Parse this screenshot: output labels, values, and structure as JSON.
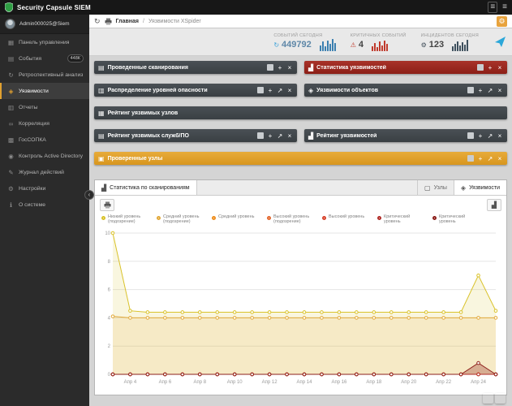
{
  "topbar": {
    "title": "Security Capsule SIEM"
  },
  "sidebar": {
    "user": "Admin000025@Siem",
    "items": [
      {
        "id": "dashboard",
        "label": "Панель управления",
        "icon": "dashboard"
      },
      {
        "id": "events",
        "label": "События",
        "icon": "events",
        "badge": "448К"
      },
      {
        "id": "retrospective",
        "label": "Ретроспективный анализ",
        "icon": "history"
      },
      {
        "id": "vulnerabilities",
        "label": "Уязвимости",
        "icon": "shield",
        "active": true
      },
      {
        "id": "reports",
        "label": "Отчеты",
        "icon": "report"
      },
      {
        "id": "correlation",
        "label": "Корреляция",
        "icon": "correlation"
      },
      {
        "id": "gossopka",
        "label": "ГосСОПКА",
        "icon": "tower"
      },
      {
        "id": "ad-control",
        "label": "Контроль Active Directory",
        "icon": "ad"
      },
      {
        "id": "action-log",
        "label": "Журнал действий",
        "icon": "journal"
      },
      {
        "id": "settings",
        "label": "Настройки",
        "icon": "settings"
      },
      {
        "id": "about",
        "label": "О системе",
        "icon": "info"
      }
    ]
  },
  "breadcrumb": {
    "home": "Главная",
    "sep": "/",
    "current": "Уязвимости XSpider"
  },
  "stats": {
    "items": [
      {
        "label": "СОБЫТИЙ СЕГОДНЯ",
        "icon": "refresh",
        "icon_color": "#3aa0d9",
        "value": "449792",
        "value_color": "#5e87a8",
        "spark": {
          "color": "#3a7fb0",
          "bars": [
            45,
            75,
            35,
            85,
            55,
            95,
            65
          ]
        }
      },
      {
        "label": "КРИТИЧНЫХ СОБЫТИЙ",
        "icon": "warning",
        "icon_color": "#c0392b",
        "value": "4",
        "value_color": "#444444",
        "spark": {
          "color": "#c0392b",
          "bars": [
            35,
            65,
            30,
            75,
            45,
            85,
            55
          ]
        }
      },
      {
        "label": "ИНЦИДЕНТОВ СЕГОДНЯ",
        "icon": "gear",
        "icon_color": "#44515c",
        "value": "123",
        "value_color": "#444444",
        "spark": {
          "color": "#3d4f5d",
          "bars": [
            40,
            60,
            80,
            45,
            70,
            50,
            90
          ]
        }
      }
    ]
  },
  "panels": {
    "items": [
      {
        "id": "scans",
        "title": "Проведенные сканирования",
        "icon": "list",
        "variant": "dark",
        "width": "half",
        "buttons": [
          "restore",
          "add",
          "close"
        ]
      },
      {
        "id": "vuln-stats",
        "title": "Статистика уязвимостей",
        "icon": "chart",
        "variant": "red",
        "width": "half",
        "buttons": [
          "restore",
          "add",
          "close"
        ]
      },
      {
        "id": "danger-levels",
        "title": "Распределение уровней опасности",
        "icon": "bars",
        "variant": "dark",
        "width": "half",
        "buttons": [
          "restore",
          "add",
          "expand",
          "close"
        ]
      },
      {
        "id": "object-vulns",
        "title": "Уязвимости объектов",
        "icon": "diamond",
        "variant": "dark",
        "width": "half",
        "buttons": [
          "restore",
          "add",
          "expand",
          "close"
        ]
      },
      {
        "id": "nodes-rating",
        "title": "Рейтинг уязвимых узлов",
        "icon": "grid",
        "variant": "dark",
        "width": "full",
        "buttons": []
      },
      {
        "id": "services-rating",
        "title": "Рейтинг уязвимых служб/ПО",
        "icon": "list",
        "variant": "dark",
        "width": "half",
        "buttons": [
          "restore",
          "add",
          "expand",
          "close"
        ]
      },
      {
        "id": "vulns-rating",
        "title": "Рейтинг уязвимостей",
        "icon": "chart",
        "variant": "dark",
        "width": "half",
        "buttons": [
          "restore",
          "add",
          "expand",
          "close"
        ]
      },
      {
        "id": "checked-nodes",
        "title": "Проверенные узлы",
        "icon": "check",
        "variant": "orange",
        "width": "full",
        "buttons": [
          "restore",
          "add",
          "expand",
          "close"
        ]
      }
    ]
  },
  "chart_panel": {
    "main_tab": {
      "label": "Статистика по сканированиям",
      "icon": "chart"
    },
    "tabs_right": [
      {
        "id": "nodes",
        "label": "Узлы",
        "icon": "monitor"
      },
      {
        "id": "vulnerabilities",
        "label": "Уязвимости",
        "icon": "diamond",
        "active": true
      }
    ]
  },
  "chart_data": {
    "type": "line",
    "x_range": [
      3,
      25
    ],
    "x": [
      3,
      4,
      5,
      6,
      7,
      8,
      9,
      10,
      11,
      12,
      13,
      14,
      15,
      16,
      17,
      18,
      19,
      20,
      21,
      22,
      23,
      24,
      25
    ],
    "x_ticks": [
      {
        "v": 4,
        "label": "Апр 4"
      },
      {
        "v": 6,
        "label": "Апр 6"
      },
      {
        "v": 8,
        "label": "Апр 8"
      },
      {
        "v": 10,
        "label": "Апр 10"
      },
      {
        "v": 12,
        "label": "Апр 12"
      },
      {
        "v": 14,
        "label": "Апр 14"
      },
      {
        "v": 16,
        "label": "Апр 16"
      },
      {
        "v": 18,
        "label": "Апр 18"
      },
      {
        "v": 20,
        "label": "Апр 20"
      },
      {
        "v": 22,
        "label": "Апр 22"
      },
      {
        "v": 24,
        "label": "Апр 24"
      }
    ],
    "ylim": [
      0,
      10
    ],
    "y_ticks": [
      0,
      2,
      4,
      6,
      8,
      10
    ],
    "legend_position": "top",
    "grid": "horizontal",
    "series": [
      {
        "name": "Низкий уровень (подозрение)",
        "color": "#d9c22a",
        "fill": true,
        "fill_opacity": 0.15,
        "values": [
          10,
          4.5,
          4.4,
          4.4,
          4.4,
          4.4,
          4.4,
          4.4,
          4.4,
          4.4,
          4.4,
          4.4,
          4.4,
          4.4,
          4.4,
          4.4,
          4.4,
          4.4,
          4.4,
          4.4,
          4.4,
          7,
          4.5
        ]
      },
      {
        "name": "Средний уровень (подозрение)",
        "color": "#e2a93b",
        "fill": true,
        "fill_opacity": 0.15,
        "values": [
          4.1,
          4,
          4,
          4,
          4,
          4,
          4,
          4,
          4,
          4,
          4,
          4,
          4,
          4,
          4,
          4,
          4,
          4,
          4,
          4,
          4,
          4,
          4
        ]
      },
      {
        "name": "Средний уровень",
        "color": "#ef8e1e",
        "fill": false,
        "values": [
          0,
          0,
          0,
          0,
          0,
          0,
          0,
          0,
          0,
          0,
          0,
          0,
          0,
          0,
          0,
          0,
          0,
          0,
          0,
          0,
          0,
          0,
          0
        ]
      },
      {
        "name": "Высокий уровень (подозрение)",
        "color": "#e4682e",
        "fill": false,
        "values": [
          0,
          0,
          0,
          0,
          0,
          0,
          0,
          0,
          0,
          0,
          0,
          0,
          0,
          0,
          0,
          0,
          0,
          0,
          0,
          0,
          0,
          0,
          0
        ]
      },
      {
        "name": "Высокий уровень",
        "color": "#d8432c",
        "fill": false,
        "values": [
          0,
          0,
          0,
          0,
          0,
          0,
          0,
          0,
          0,
          0,
          0,
          0,
          0,
          0,
          0,
          0,
          0,
          0,
          0,
          0,
          0,
          0,
          0
        ]
      },
      {
        "name": "Критический уровень (подозрение)",
        "color": "#b22c27",
        "fill": false,
        "values": [
          0,
          0,
          0,
          0,
          0,
          0,
          0,
          0,
          0,
          0,
          0,
          0,
          0,
          0,
          0,
          0,
          0,
          0,
          0,
          0,
          0,
          0,
          0
        ]
      },
      {
        "name": "Критический уровень",
        "color": "#8e201c",
        "fill": true,
        "fill_opacity": 0.3,
        "values": [
          0,
          0,
          0,
          0,
          0,
          0,
          0,
          0,
          0,
          0,
          0,
          0,
          0,
          0,
          0,
          0,
          0,
          0,
          0,
          0,
          0,
          0.8,
          0
        ]
      }
    ]
  },
  "fab_buttons": [
    {
      "id": "scroll-top",
      "icon": "arrow-up",
      "color": "#d9534f"
    },
    {
      "id": "add-widget",
      "icon": "plus",
      "color": "#2aa3dc"
    }
  ]
}
